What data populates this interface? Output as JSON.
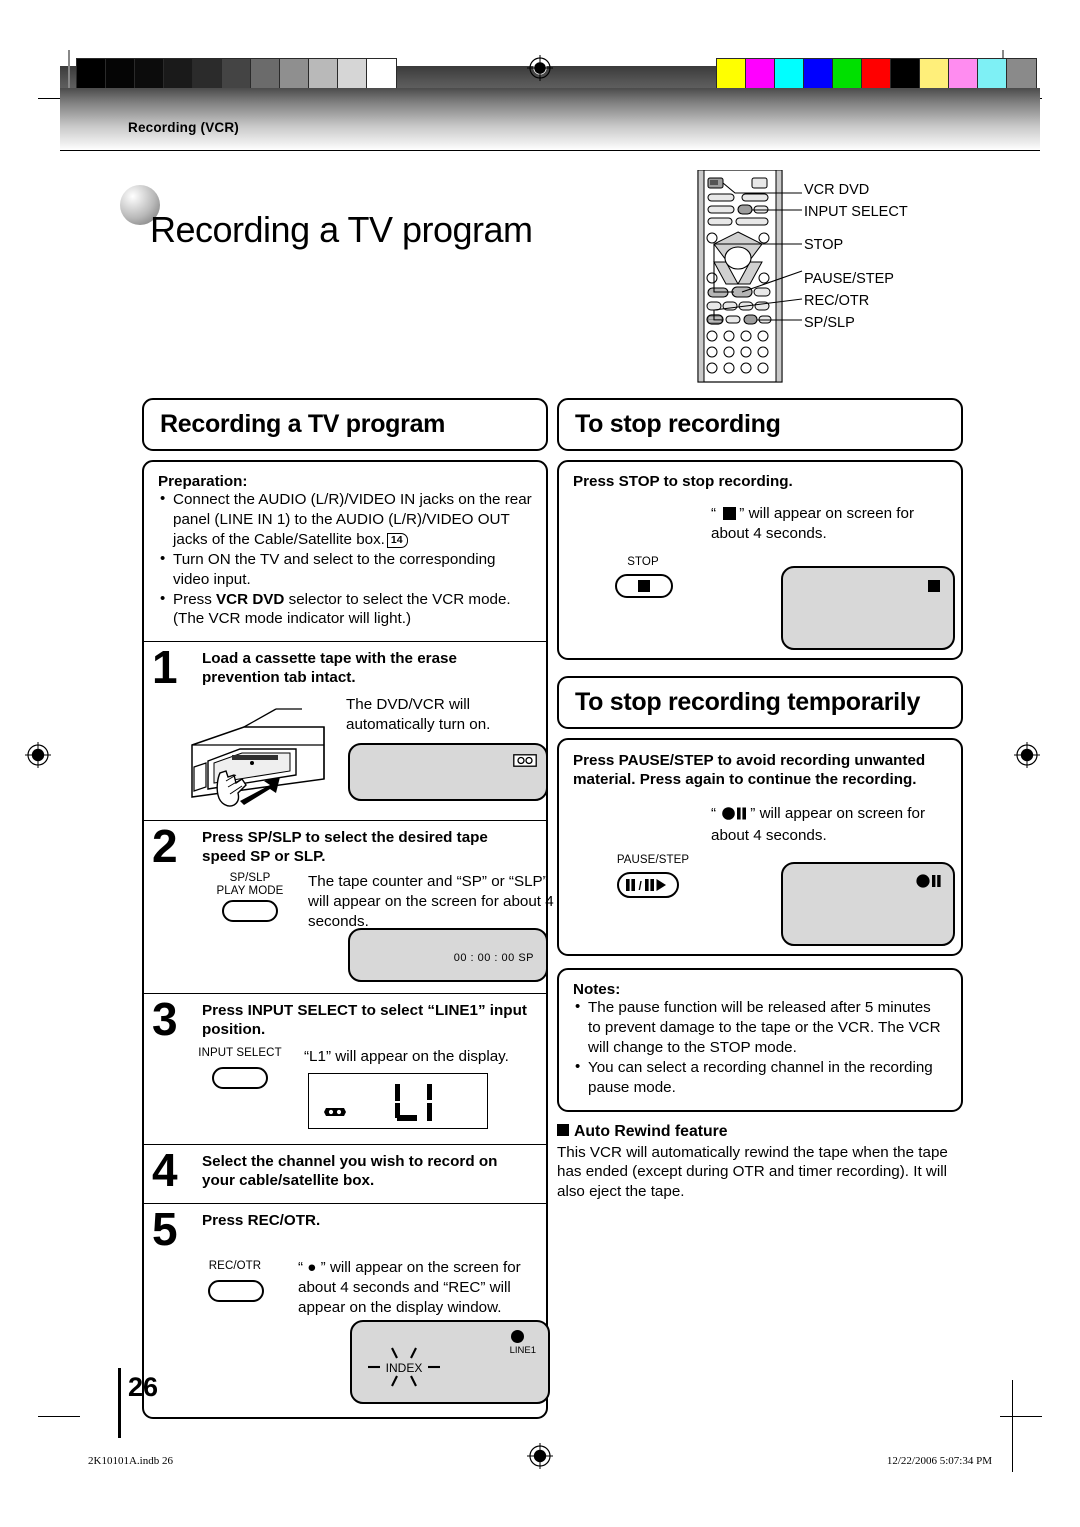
{
  "running_head": "Recording (VCR)",
  "page_title": "Recording a TV program",
  "remote": {
    "labels": [
      "VCR DVD",
      "INPUT SELECT",
      "STOP",
      "PAUSE/STEP",
      "REC/OTR",
      "SP/SLP"
    ]
  },
  "left_column": {
    "section_title": "Recording a TV program",
    "preparation": {
      "label": "Preparation:",
      "items": [
        "Connect the AUDIO (L/R)/VIDEO IN jacks on the rear panel (LINE IN 1) to the AUDIO (L/R)/VIDEO OUT jacks of the Cable/Satellite box.",
        "Turn ON the TV and select to the corresponding video input.",
        "Press VCR DVD selector to select the VCR mode. (The VCR mode indicator will light.)"
      ],
      "page_ref": "14"
    },
    "steps": [
      {
        "number": "1",
        "heading": "Load a cassette tape with the erase prevention tab intact.",
        "body": "The DVD/VCR will automatically turn on.",
        "screen_osd": "cassette-icon"
      },
      {
        "number": "2",
        "heading": "Press SP/SLP to select the desired tape speed SP or SLP.",
        "button_label_line1": "SP/SLP",
        "button_label_line2": "PLAY MODE",
        "body": "The tape counter and “SP” or “SLP” will appear on the screen for about 4 seconds.",
        "screen_osd": "00 : 00 : 00  SP"
      },
      {
        "number": "3",
        "heading": "Press INPUT SELECT to select “LINE1” input position.",
        "button_label_line1": "INPUT SELECT",
        "body": "“L1” will appear on the display.",
        "lcd_value": "L1"
      },
      {
        "number": "4",
        "heading": "Select the channel you wish to record on your cable/satellite box."
      },
      {
        "number": "5",
        "heading": "Press REC/OTR.",
        "button_label_line1": "REC/OTR",
        "body": "“ ● ” will appear on the screen for about 4 seconds and “REC” will appear on the display window.",
        "screen_osd_line": "LINE1",
        "screen_osd_index": "INDEX"
      }
    ]
  },
  "right_column": {
    "stop_recording": {
      "section_title": "To stop recording",
      "heading": "Press STOP to stop recording.",
      "body_prefix": "“",
      "body_suffix": "” will appear on screen for about 4 seconds.",
      "button_label": "STOP"
    },
    "stop_temporarily": {
      "section_title": "To stop recording temporarily",
      "heading": "Press PAUSE/STEP to avoid recording unwanted material. Press again to continue the recording.",
      "body_prefix": "“",
      "body_suffix": "” will appear on screen for about 4 seconds.",
      "button_label": "PAUSE/STEP",
      "button_glyph": "II/II▶"
    },
    "notes": {
      "label": "Notes:",
      "items": [
        "The pause function will be released after 5 minutes to prevent damage to the tape or the VCR. The VCR will change to the STOP mode.",
        "You can select a recording channel in the recording pause mode."
      ]
    },
    "auto_rewind": {
      "heading": "Auto Rewind feature",
      "body": "This VCR will automatically rewind the tape when the tape has ended (except during OTR and timer recording). It will also eject the tape."
    }
  },
  "footer": {
    "page_number": "26",
    "file_name": "2K10101A.indb   26",
    "timestamp": "12/22/2006   5:07:34 PM"
  },
  "calibration": {
    "gray_patches": [
      "#000000",
      "#050505",
      "#0c0c0c",
      "#1a1a1a",
      "#2b2b2b",
      "#444444",
      "#6b6b6b",
      "#8f8f8f",
      "#b9b9b9",
      "#d6d6d6",
      "#ffffff"
    ],
    "color_patches": [
      "#ffff00",
      "#ff00ff",
      "#00ffff",
      "#0000ff",
      "#00e000",
      "#ff0000",
      "#000000",
      "#ffef7a",
      "#ff8cf0",
      "#7ef0f5",
      "#8a8a8a"
    ]
  }
}
